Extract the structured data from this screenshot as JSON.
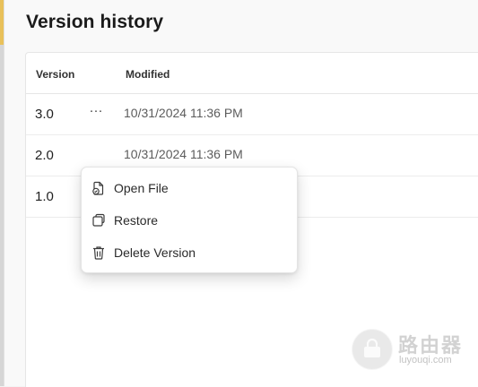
{
  "dialog": {
    "title": "Version history"
  },
  "table": {
    "headers": {
      "version": "Version",
      "modified": "Modified"
    },
    "rows": [
      {
        "version": "3.0",
        "modified": "10/31/2024 11:36 PM",
        "more_label": "···"
      },
      {
        "version": "2.0",
        "modified": "10/31/2024 11:36 PM"
      },
      {
        "version": "1.0",
        "modified": ""
      }
    ]
  },
  "context_menu": {
    "items": [
      {
        "label": "Open File",
        "icon": "open-file-icon"
      },
      {
        "label": "Restore",
        "icon": "restore-icon"
      },
      {
        "label": "Delete Version",
        "icon": "trash-icon"
      }
    ]
  },
  "watermark": {
    "title": "路由器",
    "subtitle": "luyouqi.com"
  },
  "colors": {
    "panel_bg": "#f9f9f9",
    "table_bg": "#ffffff",
    "text_primary": "#1f1f1f",
    "text_secondary": "#5c5c5c"
  }
}
